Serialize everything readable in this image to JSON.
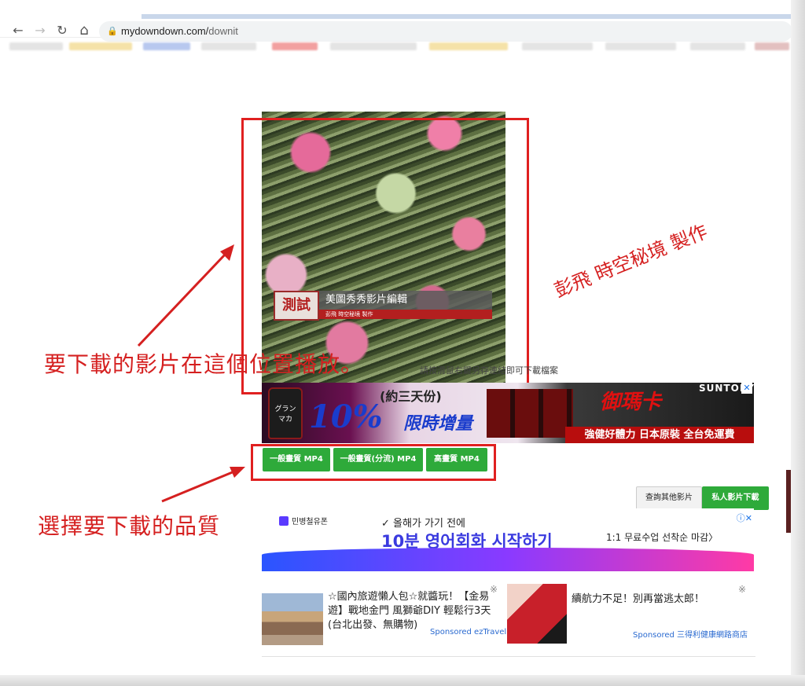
{
  "browser": {
    "url_host": "mydowndown.com/",
    "url_path": "downit",
    "back_icon": "←",
    "forward_icon": "→",
    "reload_icon": "↻",
    "home_icon": "⌂",
    "lock_icon": "🔒"
  },
  "video": {
    "caption_tag": "測試",
    "caption_title": "美圖秀秀影片編輯",
    "caption_sub": "彭飛 時空秘境 製作"
  },
  "annotations": {
    "video_hint": "要下載的影片在這個位置播放。",
    "quality_hint": "選擇要下載的品質",
    "credit": "彭飛 時空秘境 製作",
    "accent_color": "#d52020"
  },
  "page": {
    "small_hint": "請按滑鼠右鍵另存連結即可下載檔案"
  },
  "ad_banner": {
    "days": "(約三天份)",
    "percent": "10%",
    "promo": "限時增量",
    "brand": "御瑪卡",
    "suntory": "SUNTORY",
    "tagline": "強健好體力 日本原裝 全台免運費",
    "bottle_label": "グラン マカ",
    "close": "✕"
  },
  "quality_buttons": {
    "normal": "一般畫質 MP4",
    "normal_split": "一般畫質(分流) MP4",
    "high": "高畫質 MP4"
  },
  "side_buttons": {
    "other": "查詢其他影片",
    "private": "私人影片下載"
  },
  "ad_korean": {
    "brand": "민병철유폰",
    "check_text": "✓ 올해가 가기 전에",
    "title": "10분 영어회화 시작하기",
    "cta": "1:1 무료수업 선착순 마감〉",
    "adchoices": "ⓘ✕"
  },
  "native_ads": {
    "item1_text": "☆國內旅遊懶人包☆就醬玩！【金易遊】戰地金門 風獅爺DIY 輕鬆行3天(台北出發、無購物)",
    "item1_sponsor": "Sponsored ezTravel",
    "item2_text": "續航力不足！別再當逃太郎！",
    "item2_sponsor": "Sponsored 三得利健康網路商店",
    "choice_icon": "※"
  }
}
